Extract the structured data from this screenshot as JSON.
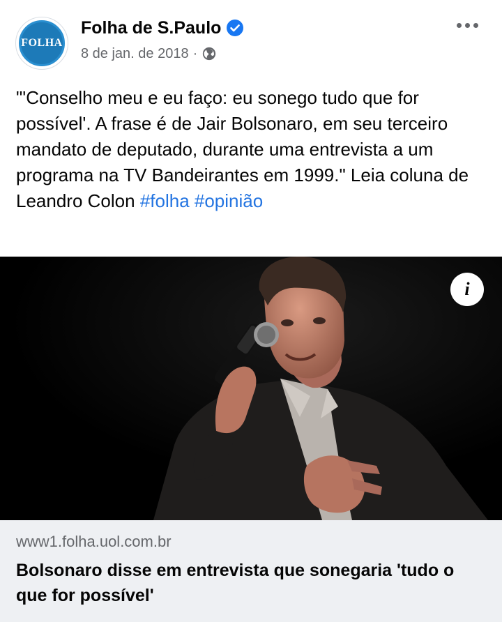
{
  "post": {
    "page_name": "Folha de S.Paulo",
    "avatar_text": "FOLHA",
    "verified_icon": "verified-badge-icon",
    "date": "8 de jan. de 2018",
    "separator": "·",
    "privacy_icon": "globe-icon",
    "more_icon": "more-options-icon",
    "text": "\"'Conselho meu e eu faço: eu sonego tudo que for possível'. A frase é de Jair Bolsonaro, em seu terceiro mandato de deputado, durante uma entrevista a um programa na TV Bandeirantes em 1999.\" Leia coluna de Leandro Colon ",
    "hashtags": [
      "#folha",
      "#opinião"
    ]
  },
  "media": {
    "info_label": "i",
    "info_icon": "info-icon"
  },
  "link_preview": {
    "domain": "www1.folha.uol.com.br",
    "title": "Bolsonaro disse em entrevista que sonegaria 'tudo o que for possível'"
  },
  "colors": {
    "hashtag": "#2374e1",
    "verified": "#1877f2",
    "meta": "#65676b",
    "link_box": "#eef0f3"
  }
}
